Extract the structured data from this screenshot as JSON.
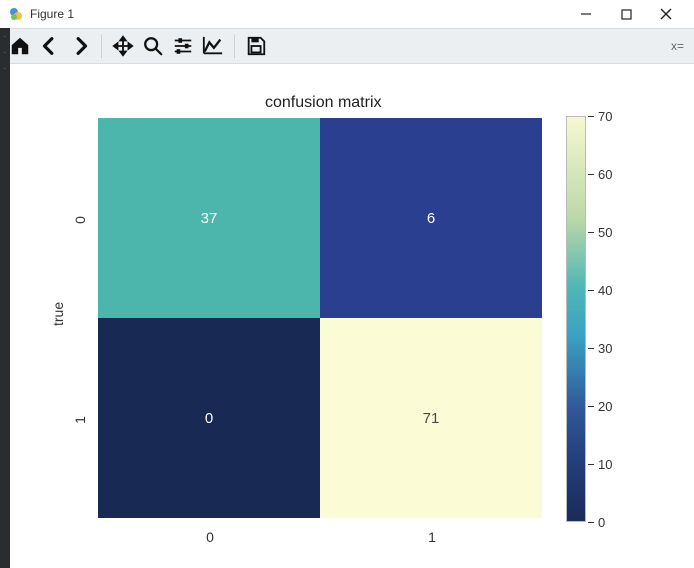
{
  "window": {
    "title": "Figure 1"
  },
  "toolbar": {
    "coords_label": "x="
  },
  "chart_data": {
    "type": "heatmap",
    "title": "confusion matrix",
    "ylabel": "true",
    "xlabel": "",
    "x_categories": [
      "0",
      "1"
    ],
    "y_categories": [
      "0",
      "1"
    ],
    "values": [
      [
        37,
        6
      ],
      [
        0,
        71
      ]
    ],
    "cell_colors": [
      [
        "#4cb6ac",
        "#2a3f8f"
      ],
      [
        "#182a54",
        "#fbfbd6"
      ]
    ],
    "cell_text_colors": [
      [
        "#ffffff",
        "#ffffff"
      ],
      [
        "#ffffff",
        "#4a4a4a"
      ]
    ],
    "colorbar": {
      "ticks": [
        "0",
        "10",
        "20",
        "30",
        "40",
        "50",
        "60",
        "70"
      ],
      "range": [
        0,
        71
      ]
    }
  }
}
